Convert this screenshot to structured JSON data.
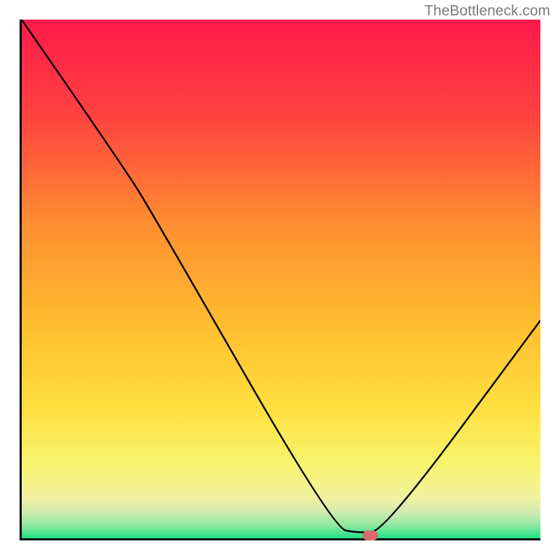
{
  "watermark": "TheBottleneck.com",
  "chart_data": {
    "type": "line",
    "title": "",
    "xlabel": "",
    "ylabel": "",
    "xlim": [
      0,
      100
    ],
    "ylim": [
      0,
      100
    ],
    "curve": [
      {
        "x": 0,
        "y": 100
      },
      {
        "x": 20,
        "y": 71
      },
      {
        "x": 25,
        "y": 63
      },
      {
        "x": 60,
        "y": 2
      },
      {
        "x": 65,
        "y": 1
      },
      {
        "x": 70,
        "y": 1.5
      },
      {
        "x": 100,
        "y": 42
      }
    ],
    "marker": {
      "x": 67,
      "y": 1
    },
    "gradient_stops": [
      {
        "pos": 0,
        "color": "#ff1a4a"
      },
      {
        "pos": 50,
        "color": "#ffa030"
      },
      {
        "pos": 75,
        "color": "#ffe040"
      },
      {
        "pos": 90,
        "color": "#f5f57a"
      },
      {
        "pos": 97,
        "color": "#a8e89a"
      },
      {
        "pos": 100,
        "color": "#1de184"
      }
    ]
  }
}
